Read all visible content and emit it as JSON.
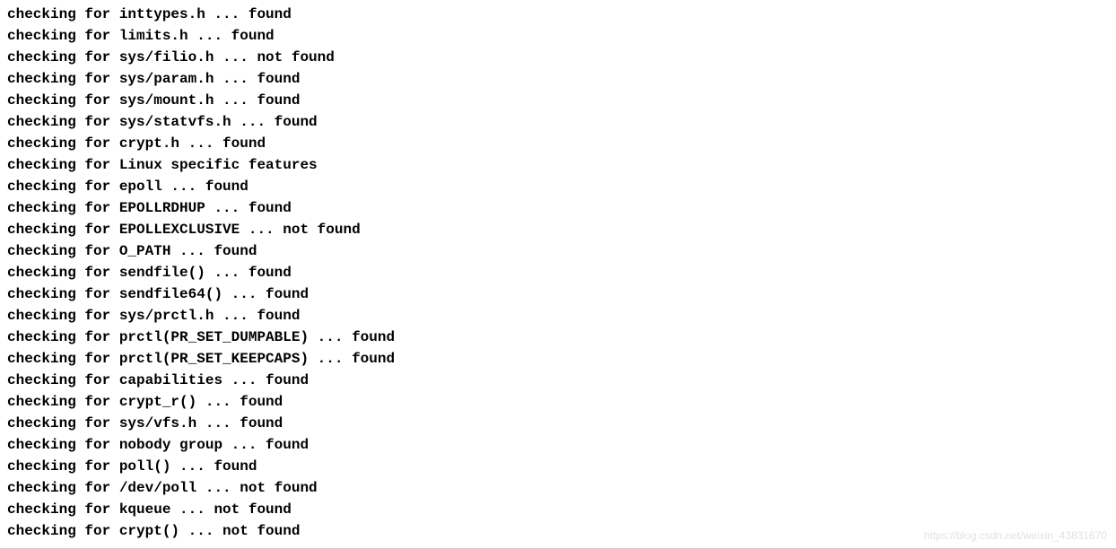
{
  "lines": [
    "checking for inttypes.h ... found",
    "checking for limits.h ... found",
    "checking for sys/filio.h ... not found",
    "checking for sys/param.h ... found",
    "checking for sys/mount.h ... found",
    "checking for sys/statvfs.h ... found",
    "checking for crypt.h ... found",
    "checking for Linux specific features",
    "checking for epoll ... found",
    "checking for EPOLLRDHUP ... found",
    "checking for EPOLLEXCLUSIVE ... not found",
    "checking for O_PATH ... found",
    "checking for sendfile() ... found",
    "checking for sendfile64() ... found",
    "checking for sys/prctl.h ... found",
    "checking for prctl(PR_SET_DUMPABLE) ... found",
    "checking for prctl(PR_SET_KEEPCAPS) ... found",
    "checking for capabilities ... found",
    "checking for crypt_r() ... found",
    "checking for sys/vfs.h ... found",
    "checking for nobody group ... found",
    "checking for poll() ... found",
    "checking for /dev/poll ... not found",
    "checking for kqueue ... not found",
    "checking for crypt() ... not found"
  ],
  "watermark": "https://blog.csdn.net/weixin_43831670"
}
